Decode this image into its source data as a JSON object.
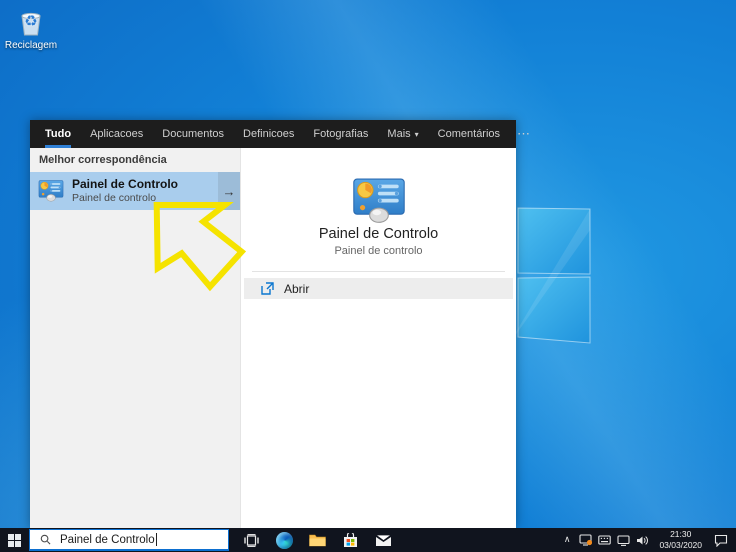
{
  "desktop": {
    "recycle_bin_label": "Reciclagem"
  },
  "icons": {
    "mais_caret": "▾",
    "ellipsis": "⋯",
    "best_match_arrow": "→",
    "tray_chevron": "∧",
    "recycle_glyph": "♻"
  },
  "search_window": {
    "tabs": {
      "tudo": "Tudo",
      "aplicacoes": "Aplicacoes",
      "documentos": "Documentos",
      "definicoes": "Definicoes",
      "fotografias": "Fotografias",
      "mais": "Mais"
    },
    "feedback_label": "Comentários",
    "section_header": "Melhor correspondência",
    "best_match": {
      "title": "Painel de Controlo",
      "subtitle": "Painel de controlo"
    },
    "preview": {
      "title": "Painel de Controlo",
      "subtitle": "Painel de controlo",
      "open_label": "Abrir"
    }
  },
  "taskbar": {
    "search_value": "Painel de Controlo",
    "clock_time": "21:30",
    "clock_date": "03/03/2020"
  },
  "colors": {
    "accent": "#0078d7",
    "selection_blue": "#a9cded",
    "header_dark": "#1d1d1d",
    "taskbar_dark": "#10141e",
    "annotation_yellow": "#f5e300"
  }
}
